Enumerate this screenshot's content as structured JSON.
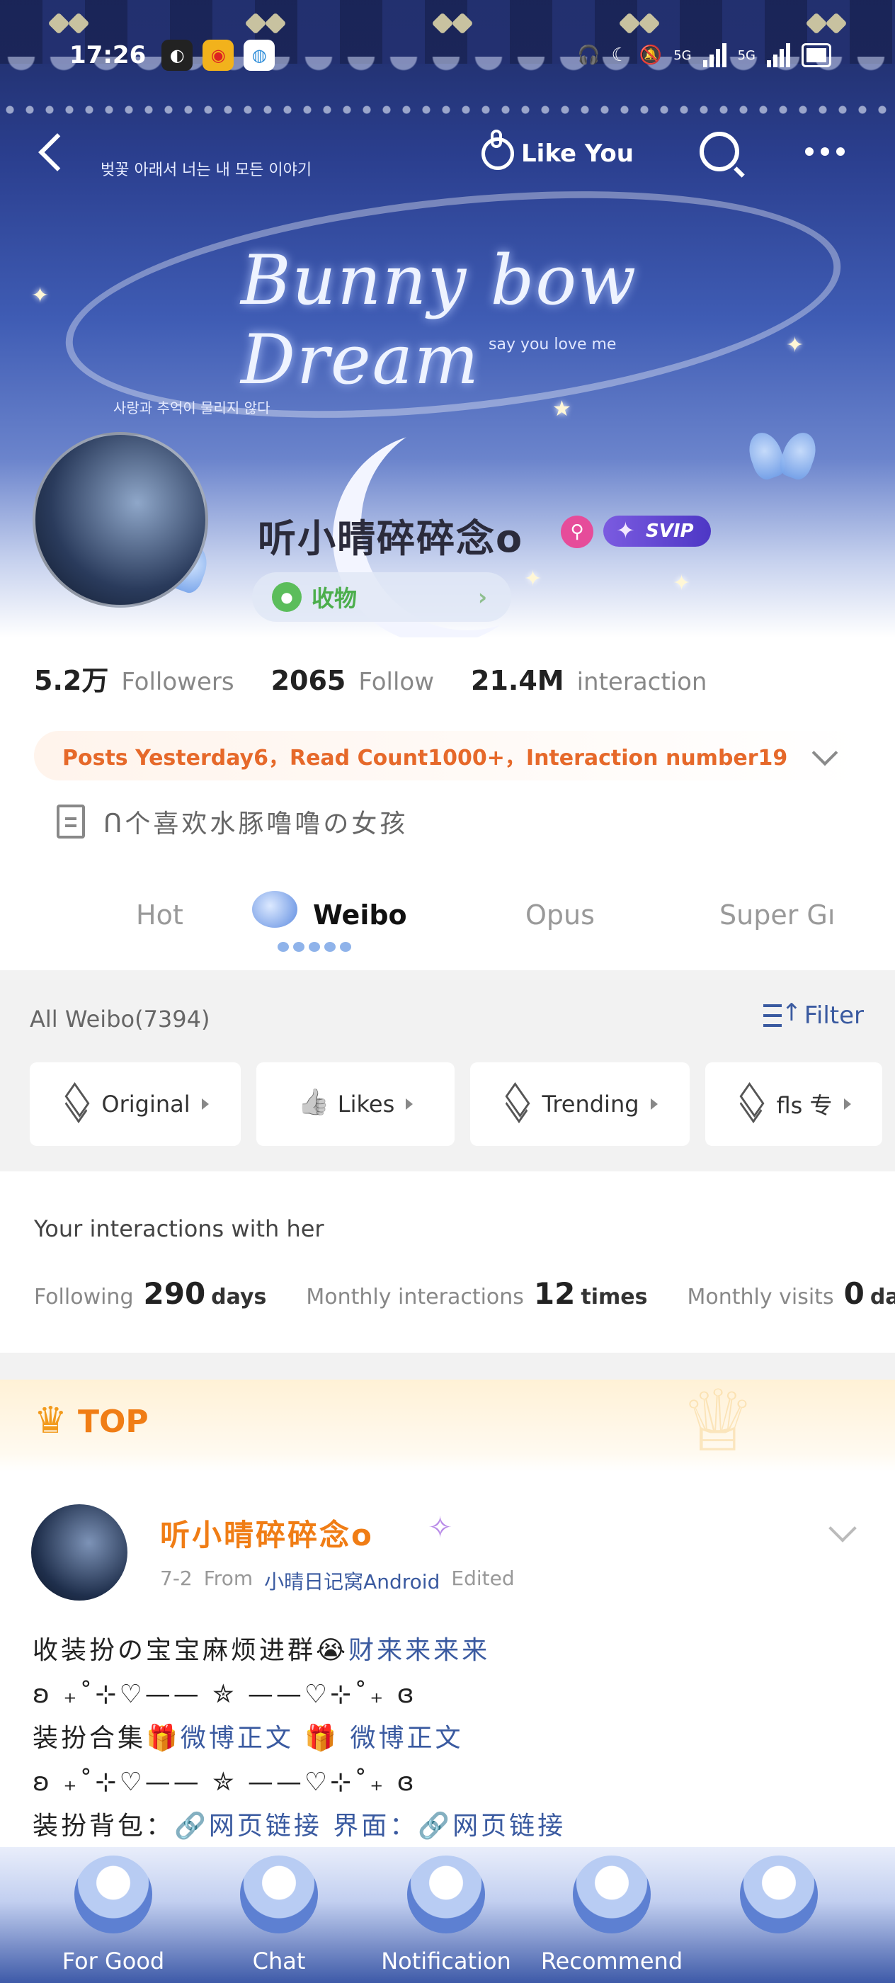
{
  "status_bar": {
    "time": "17:26",
    "network": [
      "5G",
      "5G"
    ]
  },
  "header": {
    "like_label": "Like You",
    "banner": {
      "title_line": "Bunny bow Dream",
      "subtitle": "say you love me",
      "korean_top": "벚꽃 아래서 너는 내 모든 이야기",
      "korean_bottom": "사랑과 추억이 물리지 않다"
    }
  },
  "profile": {
    "name": "听小晴碎碎念o",
    "badge": "SVIP",
    "collection_label": "收物",
    "followers": {
      "value": "5.2万",
      "label": "Followers"
    },
    "following": {
      "value": "2065",
      "label": "Follow"
    },
    "interaction": {
      "value": "21.4M",
      "label": "interaction"
    },
    "highlight": "Posts Yesterday6，Read Count1000+，Interaction number19",
    "bio": "ᑎ个喜欢水豚噜噜の女孩"
  },
  "tabs": [
    {
      "label": "Hot",
      "active": false
    },
    {
      "label": "Weibo",
      "active": true
    },
    {
      "label": "Opus",
      "active": false
    },
    {
      "label": "Super Gı",
      "active": false
    }
  ],
  "filter": {
    "all_weibo": "All Weibo(7394)",
    "filter_label": "Filter",
    "chips": [
      "Original",
      "Likes",
      "Trending",
      "fls 专"
    ]
  },
  "interactions": {
    "title": "Your interactions with her",
    "following_label": "Following",
    "following_value": "290",
    "following_unit": "days",
    "monthly_interactions_label": "Monthly interactions",
    "monthly_interactions_value": "12",
    "monthly_interactions_unit": "times",
    "monthly_visits_label": "Monthly visits",
    "monthly_visits_value": "0",
    "monthly_visits_unit": "days"
  },
  "top_post": {
    "top_label": "TOP",
    "author": "听小晴碎碎念o",
    "date": "7-2",
    "from_label": "From",
    "source": "小晴日记窝Android",
    "edited": "Edited",
    "lines": [
      {
        "text": "收装扮の宝宝麻烦进群😭",
        "link": "财来来来来"
      },
      {
        "text": "ʚ ₊˚⊹♡—— ✮ ——♡⊹˚₊ ɞ",
        "link": ""
      },
      {
        "text": "装扮合集🎁",
        "link": "微博正文 🎁 微博正文"
      },
      {
        "text": "ʚ ₊˚⊹♡—— ✮ ——♡⊹˚₊ ɞ",
        "link": ""
      },
      {
        "text": "装扮背包：",
        "link": "🔗网页链接 界面：🔗网页链接"
      }
    ]
  },
  "bottom_nav": [
    "For Good",
    "Chat",
    "Notification",
    "Recommend"
  ]
}
